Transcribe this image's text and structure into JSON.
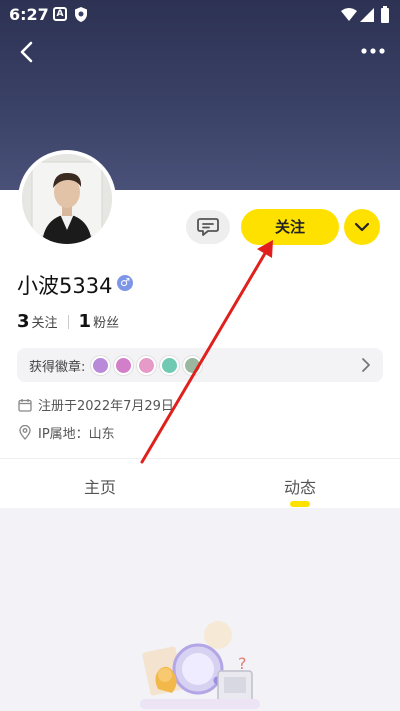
{
  "status_bar": {
    "time": "6:27",
    "icons": [
      "a-notification-icon",
      "shield-icon",
      "wifi-icon",
      "signal-icon",
      "battery-icon"
    ]
  },
  "nav": {
    "back_icon": "chevron-left-icon",
    "more_icon": "more-dots-icon"
  },
  "profile": {
    "username": "小波5334",
    "gender_symbol": "♂",
    "following_count": "3",
    "following_label": "关注",
    "followers_count": "1",
    "followers_label": "粉丝",
    "badges_label": "获得徽章:",
    "badge_colors": [
      "#b88ad8",
      "#d27ec8",
      "#e59ac8",
      "#6fc9b3",
      "#9bb7a0"
    ],
    "registered": "注册于2022年7月29日",
    "ip_location": "IP属地：山东"
  },
  "actions": {
    "follow_label": "关注",
    "message_icon": "chat-bubble-icon",
    "dropdown_icon": "chevron-down-icon"
  },
  "tabs": [
    {
      "label": "主页",
      "active": false
    },
    {
      "label": "动态",
      "active": true
    }
  ],
  "colors": {
    "accent": "#ffe100",
    "header_dark": "#2d3253",
    "arrow": "#e0201c"
  }
}
